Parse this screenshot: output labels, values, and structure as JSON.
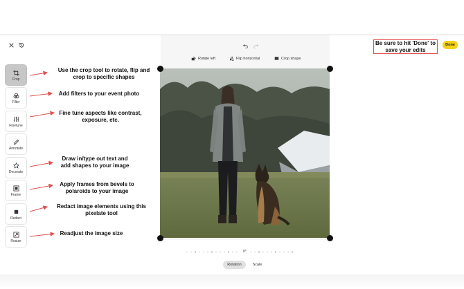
{
  "toolbar": {
    "close_icon": "close-icon",
    "history_icon": "history-icon"
  },
  "tools": [
    {
      "label": "Crop",
      "icon": "crop-icon",
      "active": true
    },
    {
      "label": "Filter",
      "icon": "filter-icon"
    },
    {
      "label": "Finetune",
      "icon": "sliders-icon"
    },
    {
      "label": "Annotate",
      "icon": "pencil-icon"
    },
    {
      "label": "Decorate",
      "icon": "star-icon"
    },
    {
      "label": "Frame",
      "icon": "frame-icon"
    },
    {
      "label": "Redact",
      "icon": "redact-icon"
    },
    {
      "label": "Resize",
      "icon": "resize-icon"
    }
  ],
  "annotations": {
    "crop": "Use the crop tool to rotate, flip and crop to specific shapes",
    "filter": "Add filters to your event photo",
    "finetune": "Fine tune aspects like contrast, exposure, etc.",
    "decorate": "Draw in/type out text and add shapes to your image",
    "frame": "Apply frames from bevels to polaroids to your image",
    "redact": "Redact image elements using this pixelate tool",
    "resize": "Readjust the image size",
    "done": "Be sure to hit 'Done' to save your edits"
  },
  "crop_tools": {
    "rotate_left": "Rotate left",
    "flip_horizontal": "Flip horizontal",
    "crop_shape": "Crop shape"
  },
  "rotation": {
    "value": "0°"
  },
  "bottom_tabs": {
    "rotation": "Rotation",
    "scale": "Scale",
    "active": "Rotation"
  },
  "done_button": "Done",
  "colors": {
    "accent": "#f4d21c",
    "annotation_red": "#e05050",
    "active_tool": "#c7c7c7"
  }
}
